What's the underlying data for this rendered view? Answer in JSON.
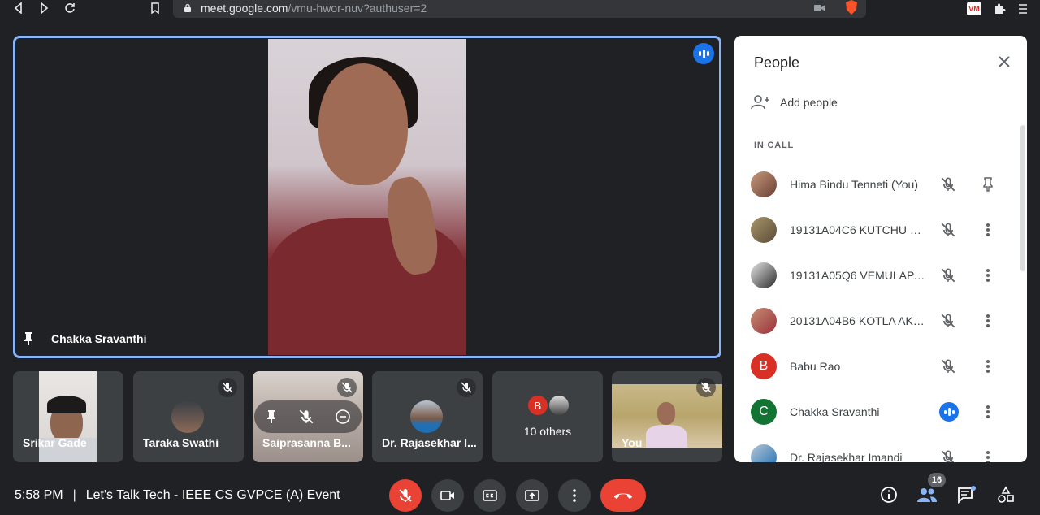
{
  "browser": {
    "url_host": "meet.google.com",
    "url_path": "/vmu-hwor-nuv?authuser=2"
  },
  "main_speaker": {
    "name": "Chakka Sravanthi"
  },
  "thumbnails": [
    {
      "name": "Srikar Gade"
    },
    {
      "name": "Taraka Swathi"
    },
    {
      "name": "Saiprasanna B..."
    },
    {
      "name": "Dr. Rajasekhar I..."
    },
    {
      "name": "10 others",
      "avatar_letter": "B"
    },
    {
      "name": "You"
    }
  ],
  "people_panel": {
    "title": "People",
    "add_people_label": "Add people",
    "section_label": "IN CALL",
    "people": [
      {
        "name": "Hima Bindu Tenneti (You)",
        "action": "pin-icon"
      },
      {
        "name": "19131A04C6 KUTCHU KO...",
        "action": "more-vert-icon"
      },
      {
        "name": "19131A05Q6 VEMULAPAL...",
        "action": "more-vert-icon"
      },
      {
        "name": "20131A04B6 KOTLA AKHI...",
        "action": "more-vert-icon"
      },
      {
        "name": "Babu Rao",
        "avatar_letter": "B",
        "avatar_color": "#d93025",
        "action": "more-vert-icon"
      },
      {
        "name": "Chakka Sravanthi",
        "avatar_letter": "C",
        "avatar_color": "#137333",
        "action": "more-vert-icon"
      },
      {
        "name": "Dr. Rajasekhar Imandi",
        "action": "more-vert-icon"
      }
    ]
  },
  "bottom_bar": {
    "time": "5:58 PM",
    "separator": "|",
    "meeting_title": "Let's Talk Tech - IEEE CS GVPCE (A) Event",
    "participant_count": "16"
  },
  "colors": {
    "accent": "#8ab4f8",
    "leave": "#ea4335",
    "speaking": "#1a73e8",
    "background": "#202124"
  }
}
